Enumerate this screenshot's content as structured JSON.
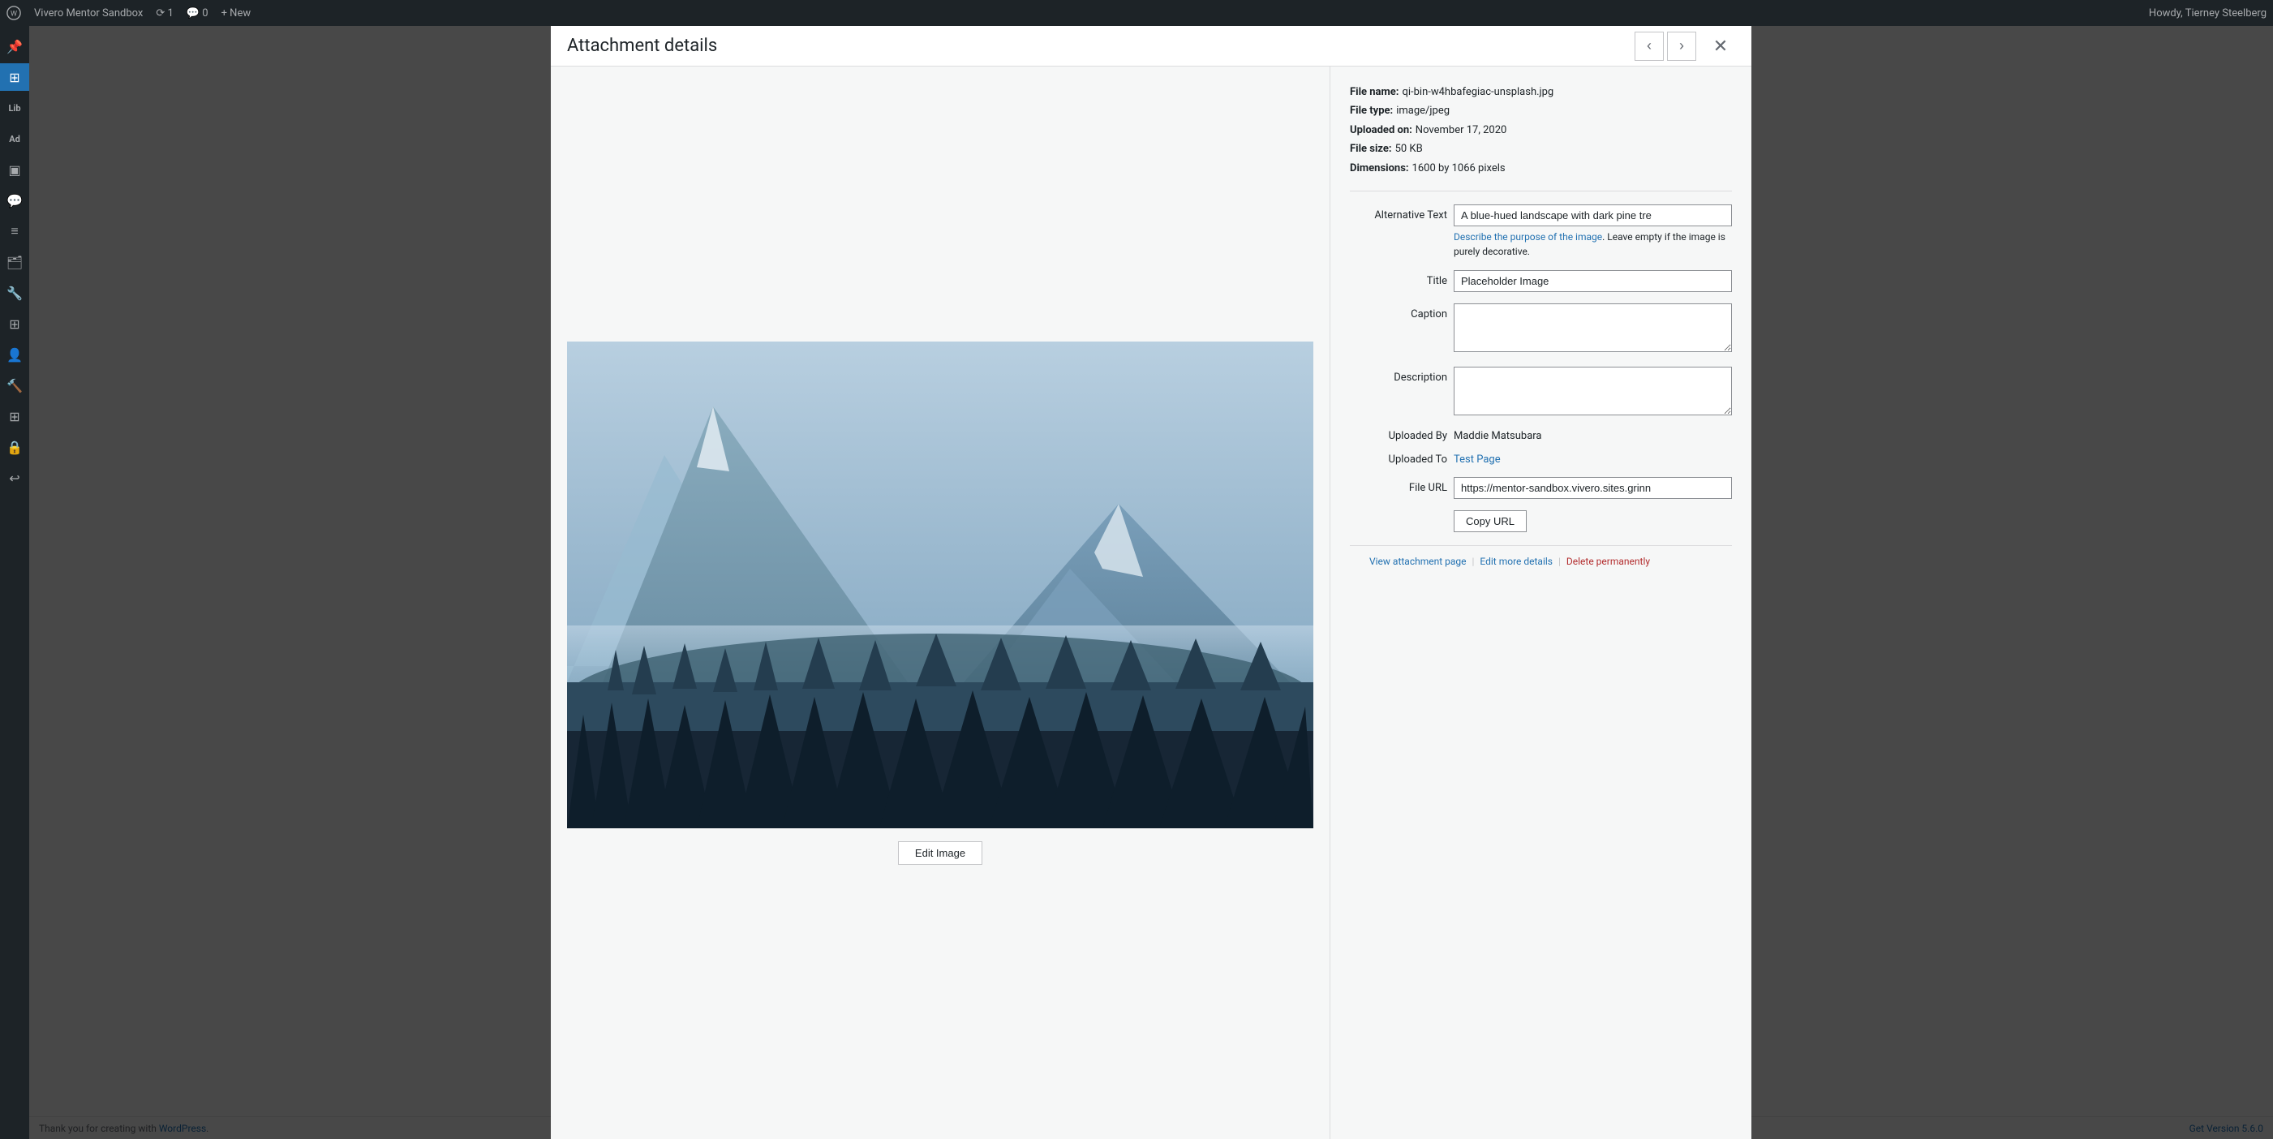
{
  "adminBar": {
    "siteName": "Vivero Mentor Sandbox",
    "updates": "1",
    "comments": "0",
    "newLabel": "+ New",
    "userGreeting": "Howdy, Tierney Steelberg"
  },
  "sidebar": {
    "icons": [
      {
        "name": "pin-icon",
        "symbol": "📌",
        "active": false
      },
      {
        "name": "dashboard-icon",
        "symbol": "⊞",
        "active": true
      },
      {
        "name": "library-label",
        "symbol": "Lib",
        "active": false
      },
      {
        "name": "add-icon",
        "symbol": "Ad",
        "active": false
      },
      {
        "name": "pages-icon",
        "symbol": "⬜",
        "active": false
      },
      {
        "name": "comments-icon",
        "symbol": "💬",
        "active": false
      },
      {
        "name": "list-icon",
        "symbol": "≡",
        "active": false
      },
      {
        "name": "folder-icon",
        "symbol": "🗂",
        "active": false
      },
      {
        "name": "tools-icon",
        "symbol": "🔧",
        "active": false
      },
      {
        "name": "build-icon",
        "symbol": "⊞",
        "active": false
      },
      {
        "name": "user-icon",
        "symbol": "👤",
        "active": false
      },
      {
        "name": "wrench-icon",
        "symbol": "🔨",
        "active": false
      },
      {
        "name": "grid-icon",
        "symbol": "⊞",
        "active": false
      },
      {
        "name": "lock-icon",
        "symbol": "🔒",
        "active": false
      },
      {
        "name": "back-icon",
        "symbol": "↩",
        "active": false
      }
    ]
  },
  "modal": {
    "title": "Attachment details",
    "prevLabel": "‹",
    "nextLabel": "›",
    "closeLabel": "✕",
    "fileInfo": {
      "fileName": {
        "label": "File name:",
        "value": "qi-bin-w4hbafegiac-unsplash.jpg"
      },
      "fileType": {
        "label": "File type:",
        "value": "image/jpeg"
      },
      "uploadedOn": {
        "label": "Uploaded on:",
        "value": "November 17, 2020"
      },
      "fileSize": {
        "label": "File size:",
        "value": "50 KB"
      },
      "dimensions": {
        "label": "Dimensions:",
        "value": "1600 by 1066 pixels"
      }
    },
    "form": {
      "altTextLabel": "Alternative Text",
      "altTextValue": "A blue-hued landscape with dark pine tre",
      "altTextHintLink": "Describe the purpose of the image",
      "altTextHint": ". Leave empty if the image is purely decorative.",
      "titleLabel": "Title",
      "titleValue": "Placeholder Image",
      "captionLabel": "Caption",
      "captionValue": "",
      "descriptionLabel": "Description",
      "descriptionValue": "",
      "uploadedByLabel": "Uploaded By",
      "uploadedByValue": "Maddie Matsubara",
      "uploadedToLabel": "Uploaded To",
      "uploadedToValue": "Test Page",
      "uploadedToUrl": "#",
      "fileUrlLabel": "File URL",
      "fileUrlValue": "https://mentor-sandbox.vivero.sites.grinn",
      "copyUrlLabel": "Copy URL"
    },
    "editImageLabel": "Edit Image",
    "footer": {
      "viewAttachment": "View attachment page",
      "editMoreDetails": "Edit more details",
      "deletePermanently": "Delete permanently"
    }
  },
  "bottomBar": {
    "thankYouText": "Thank you for creating with",
    "wordpressLink": "WordPress",
    "version": "Get Version 5.6.0"
  }
}
